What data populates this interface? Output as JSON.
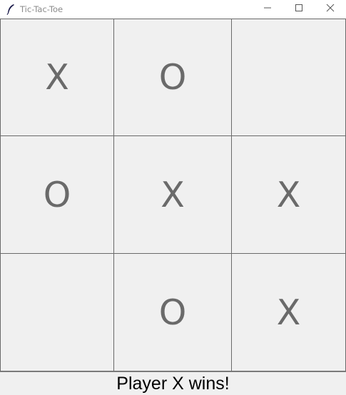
{
  "window": {
    "title": "Tic-Tac-Toe",
    "controls": [
      "minimize-icon",
      "maximize-icon",
      "close-icon"
    ],
    "app_icon": "feather-icon"
  },
  "board": {
    "cells": [
      [
        "X",
        "O",
        ""
      ],
      [
        "O",
        "X",
        "X"
      ],
      [
        "",
        "O",
        "X"
      ]
    ]
  },
  "status": {
    "text": "Player X wins!"
  },
  "colors": {
    "mark": "#6a6a6a",
    "background": "#f0f0f0",
    "cell_border": "#6a6a6a",
    "status_text": "#000000"
  }
}
